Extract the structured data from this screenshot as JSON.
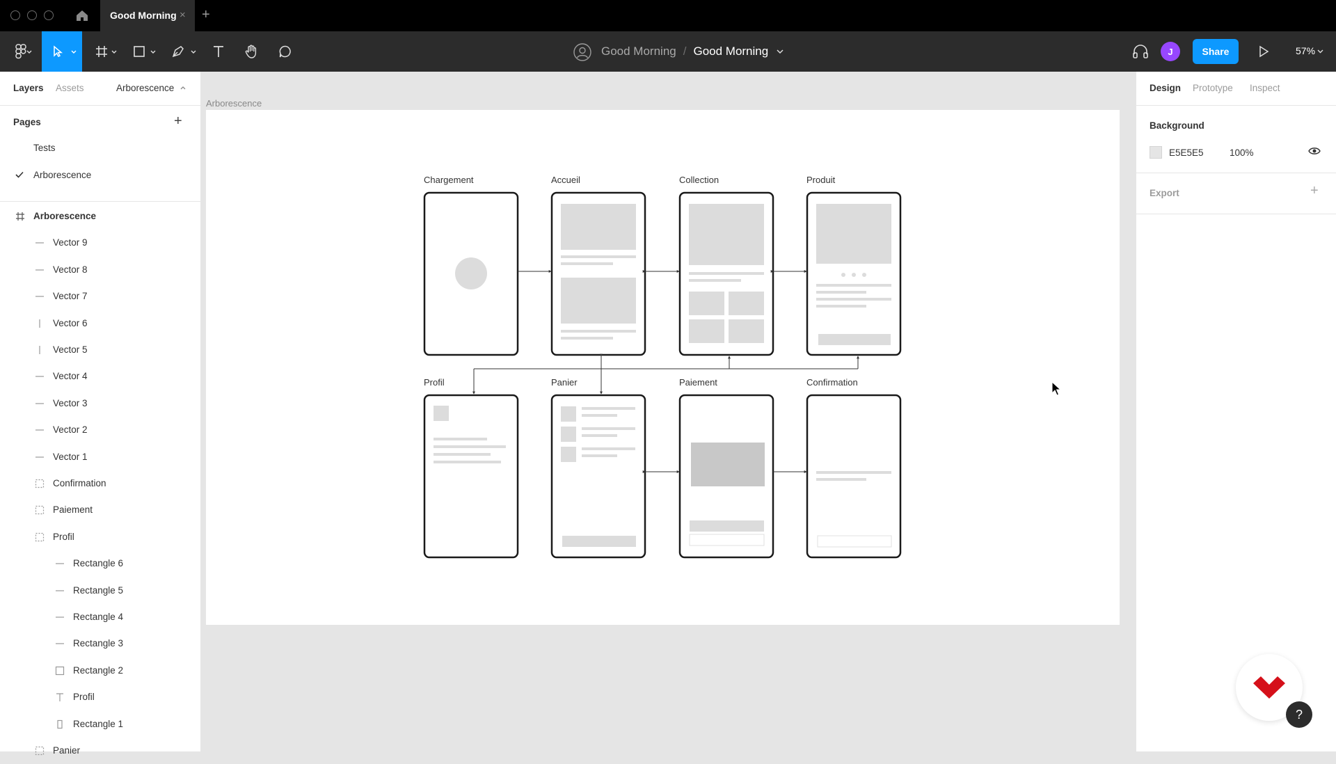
{
  "titlebar": {
    "tab_title": "Good Morning",
    "tab_close": "×",
    "new_tab": "+"
  },
  "toolbar": {
    "team": "Good Morning",
    "separator": "/",
    "file": "Good Morning",
    "share": "Share",
    "avatar_initial": "J",
    "zoom": "57%"
  },
  "left": {
    "tabs": [
      "Layers",
      "Assets"
    ],
    "page_selector": "Arborescence",
    "pages_heading": "Pages",
    "pages_add": "+",
    "pages": [
      {
        "label": "Tests",
        "active": false
      },
      {
        "label": "Arborescence",
        "active": true
      }
    ],
    "layers": [
      {
        "label": "Arborescence",
        "icon": "frame-icon",
        "depth": 0,
        "bold": true
      },
      {
        "label": "Vector 9",
        "icon": "line-h-icon",
        "depth": 1
      },
      {
        "label": "Vector 8",
        "icon": "line-h-icon",
        "depth": 1
      },
      {
        "label": "Vector 7",
        "icon": "line-h-icon",
        "depth": 1
      },
      {
        "label": "Vector 6",
        "icon": "line-v-icon",
        "depth": 1
      },
      {
        "label": "Vector 5",
        "icon": "line-v-icon",
        "depth": 1
      },
      {
        "label": "Vector 4",
        "icon": "line-h-icon",
        "depth": 1
      },
      {
        "label": "Vector 3",
        "icon": "line-h-icon",
        "depth": 1
      },
      {
        "label": "Vector 2",
        "icon": "line-h-icon",
        "depth": 1
      },
      {
        "label": "Vector 1",
        "icon": "line-h-icon",
        "depth": 1
      },
      {
        "label": "Confirmation",
        "icon": "group-icon",
        "depth": 1
      },
      {
        "label": "Paiement",
        "icon": "group-icon",
        "depth": 1
      },
      {
        "label": "Profil",
        "icon": "group-icon",
        "depth": 1
      },
      {
        "label": "Rectangle 6",
        "icon": "line-h-icon",
        "depth": 2
      },
      {
        "label": "Rectangle 5",
        "icon": "line-h-icon",
        "depth": 2
      },
      {
        "label": "Rectangle 4",
        "icon": "line-h-icon",
        "depth": 2
      },
      {
        "label": "Rectangle 3",
        "icon": "line-h-icon",
        "depth": 2
      },
      {
        "label": "Rectangle 2",
        "icon": "rectangle-icon",
        "depth": 2
      },
      {
        "label": "Profil",
        "icon": "text-icon",
        "depth": 2
      },
      {
        "label": "Rectangle 1",
        "icon": "rect-tall-icon",
        "depth": 2
      },
      {
        "label": "Panier",
        "icon": "group-icon",
        "depth": 1
      }
    ]
  },
  "canvas": {
    "frame_label": "Arborescence",
    "screens_top": [
      "Chargement",
      "Accueil",
      "Collection",
      "Produit"
    ],
    "screens_bottom": [
      "Profil",
      "Panier",
      "Paiement",
      "Confirmation"
    ]
  },
  "right": {
    "tabs": [
      "Design",
      "Prototype",
      "Inspect"
    ],
    "background_title": "Background",
    "background_hex": "E5E5E5",
    "background_opacity": "100%",
    "export_title": "Export",
    "export_add": "+"
  },
  "colors": {
    "accent": "#0d99ff",
    "avatar": "#9747ff",
    "canvas": "#e5e5e5",
    "logo": "#d5101a"
  }
}
